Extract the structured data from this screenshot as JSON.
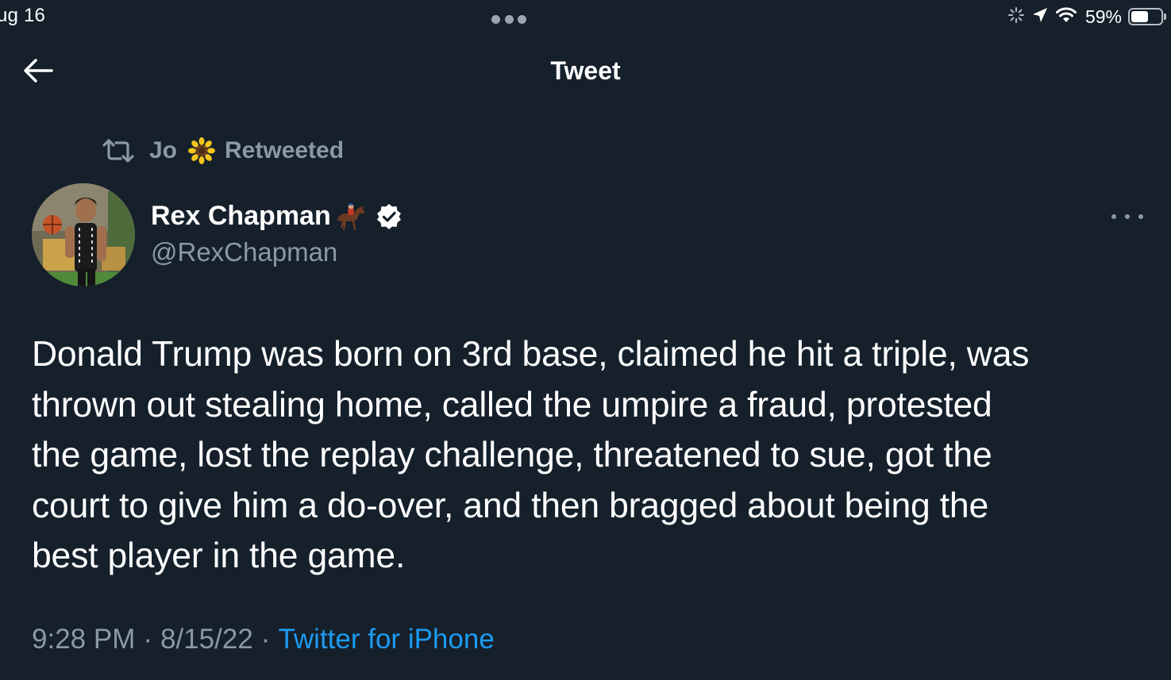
{
  "status_bar": {
    "date": "ug 16",
    "battery_percent": "59%",
    "battery_level": 0.59,
    "icons": [
      "loading-spinner-icon",
      "location-arrow-icon",
      "wifi-icon",
      "battery-icon"
    ]
  },
  "header": {
    "back_icon": "arrow-left-icon",
    "title": "Tweet"
  },
  "retweet": {
    "icon": "retweet-icon",
    "user": "Jo",
    "emoji": "sunflower-emoji",
    "label": "Retweeted"
  },
  "author": {
    "name": "Rex Chapman",
    "name_emoji": "horse-racing-emoji",
    "verified": true,
    "handle": "@RexChapman"
  },
  "tweet": {
    "lines": [
      "Donald Trump was born on 3rd base, claimed he hit a triple, was",
      "thrown out stealing home, called the umpire a fraud, protested",
      "the game, lost the replay challenge, threatened to sue, got the",
      "court to give him a do-over, and then bragged about being the",
      "best player in the game."
    ],
    "time": "9:28 PM",
    "separator": "·",
    "date": "8/15/22",
    "source": "Twitter for iPhone"
  },
  "colors": {
    "background": "#15202b",
    "text": "#ffffff",
    "secondary": "#8b98a5",
    "accent": "#1d9bf0"
  }
}
